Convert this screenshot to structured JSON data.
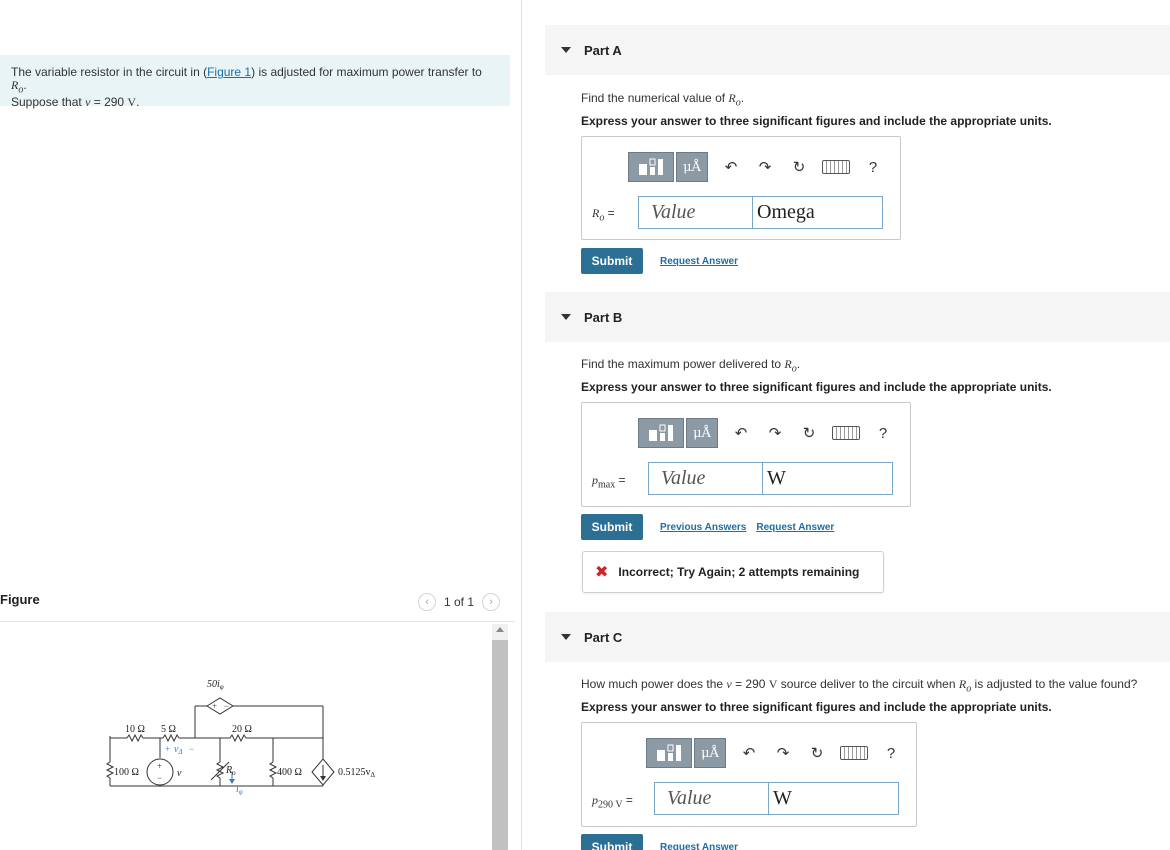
{
  "problem": {
    "text_before_link": "The variable resistor in the circuit in (",
    "link": "Figure 1",
    "text_after_link": ") is adjusted for maximum power transfer to ",
    "ro": "R",
    "ro_sub": "o",
    "line2_prefix": "Suppose that ",
    "v_var": "v",
    "line2_eq": " = 290 ",
    "v_unit": "V"
  },
  "figure": {
    "title": "Figure",
    "pager": "1 of 1",
    "labels": {
      "dep_src": "50i",
      "dep_src_sub": "φ",
      "r10": "10 Ω",
      "r5": "5 Ω",
      "r20": "20 Ω",
      "vdelta": "v",
      "vdelta_sub": "Δ",
      "r100": "100 Ω",
      "vsrc": "v",
      "ro": "R",
      "ro_sub": "o",
      "iphi": "i",
      "iphi_sub": "φ",
      "r400": "400 Ω",
      "cur_src": "0.5125v",
      "cur_src_sub": "Δ"
    }
  },
  "parts": [
    {
      "title": "Part A",
      "question_prefix": "Find the numerical value of ",
      "question_var": "R",
      "question_sub": "o",
      "instruction": "Express your answer to three significant figures and include the appropriate units.",
      "var_label": "R",
      "var_sub": "o",
      "var_eq": " =",
      "value_placeholder": "Value",
      "unit_value": "Omega",
      "submit": "Submit",
      "links": [
        "Request Answer"
      ]
    },
    {
      "title": "Part B",
      "question_prefix": "Find the maximum power delivered to ",
      "question_var": "R",
      "question_sub": "o",
      "instruction": "Express your answer to three significant figures and include the appropriate units.",
      "var_label": "p",
      "var_sub": "max",
      "var_eq": " =",
      "value_placeholder": "Value",
      "unit_value": "W",
      "submit": "Submit",
      "links": [
        "Previous Answers",
        "Request Answer"
      ],
      "feedback": "Incorrect; Try Again; 2 attempts remaining"
    },
    {
      "title": "Part C",
      "question_prefix": "How much power does the ",
      "question_var": "v",
      "question_mid": " = 290 ",
      "question_unit": "V",
      "question_suffix": " source deliver to the circuit when ",
      "question_var2": "R",
      "question_sub2": "o",
      "question_end": " is adjusted to the value found?",
      "instruction": "Express your answer to three significant figures and include the appropriate units.",
      "var_label": "p",
      "var_sub": "290 V",
      "var_eq": " =",
      "value_placeholder": "Value",
      "unit_value": "W",
      "submit": "Submit",
      "links": [
        "Request Answer"
      ]
    }
  ],
  "toolbar": {
    "unit_icon": "μÅ",
    "undo_icon": "undo-icon",
    "redo_icon": "redo-icon",
    "reset_icon": "reset-icon",
    "keyboard_icon": "keyboard-icon",
    "help": "?"
  },
  "colors": {
    "submit_bg": "#2b6f95",
    "problem_bg": "#e8f4f6",
    "error": "#c8242b"
  }
}
